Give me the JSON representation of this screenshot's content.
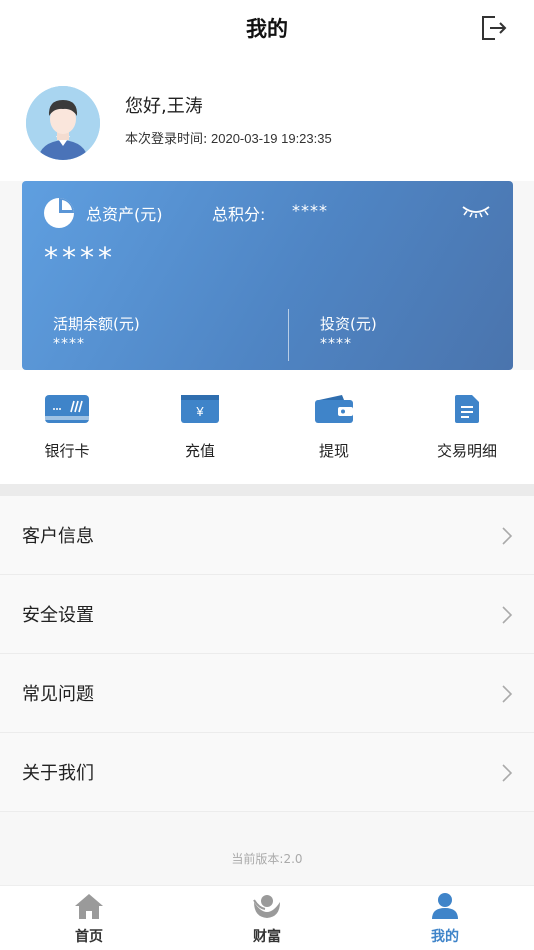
{
  "header": {
    "title": "我的",
    "logout_icon": "logout-icon"
  },
  "profile": {
    "greeting": "您好,王涛",
    "login_time_label": "本次登录时间:",
    "login_time_value": " 2020-03-19 19:23:35"
  },
  "asset_card": {
    "total_assets_label": "总资产(元)",
    "total_assets_value": "****",
    "points_label": "总积分:",
    "points_value": "****",
    "demand_balance_label": "活期余额(元)",
    "demand_balance_value": "****",
    "investment_label": "投资(元)",
    "investment_value": "****",
    "colors": {
      "start": "#5f9fe0",
      "end": "#4a74ad"
    }
  },
  "quick_actions": [
    {
      "label": "银行卡",
      "icon": "bank-card-icon"
    },
    {
      "label": "充值",
      "icon": "recharge-icon"
    },
    {
      "label": "提现",
      "icon": "wallet-icon"
    },
    {
      "label": "交易明细",
      "icon": "document-icon"
    }
  ],
  "menu": [
    {
      "label": "客户信息"
    },
    {
      "label": "安全设置"
    },
    {
      "label": "常见问题"
    },
    {
      "label": "关于我们"
    }
  ],
  "version_text": "当前版本:2.0",
  "tabbar": [
    {
      "label": "首页",
      "icon": "home-icon"
    },
    {
      "label": "财富",
      "icon": "wealth-icon"
    },
    {
      "label": "我的",
      "icon": "user-icon",
      "active": true
    }
  ],
  "accent_color": "#3f84c9"
}
